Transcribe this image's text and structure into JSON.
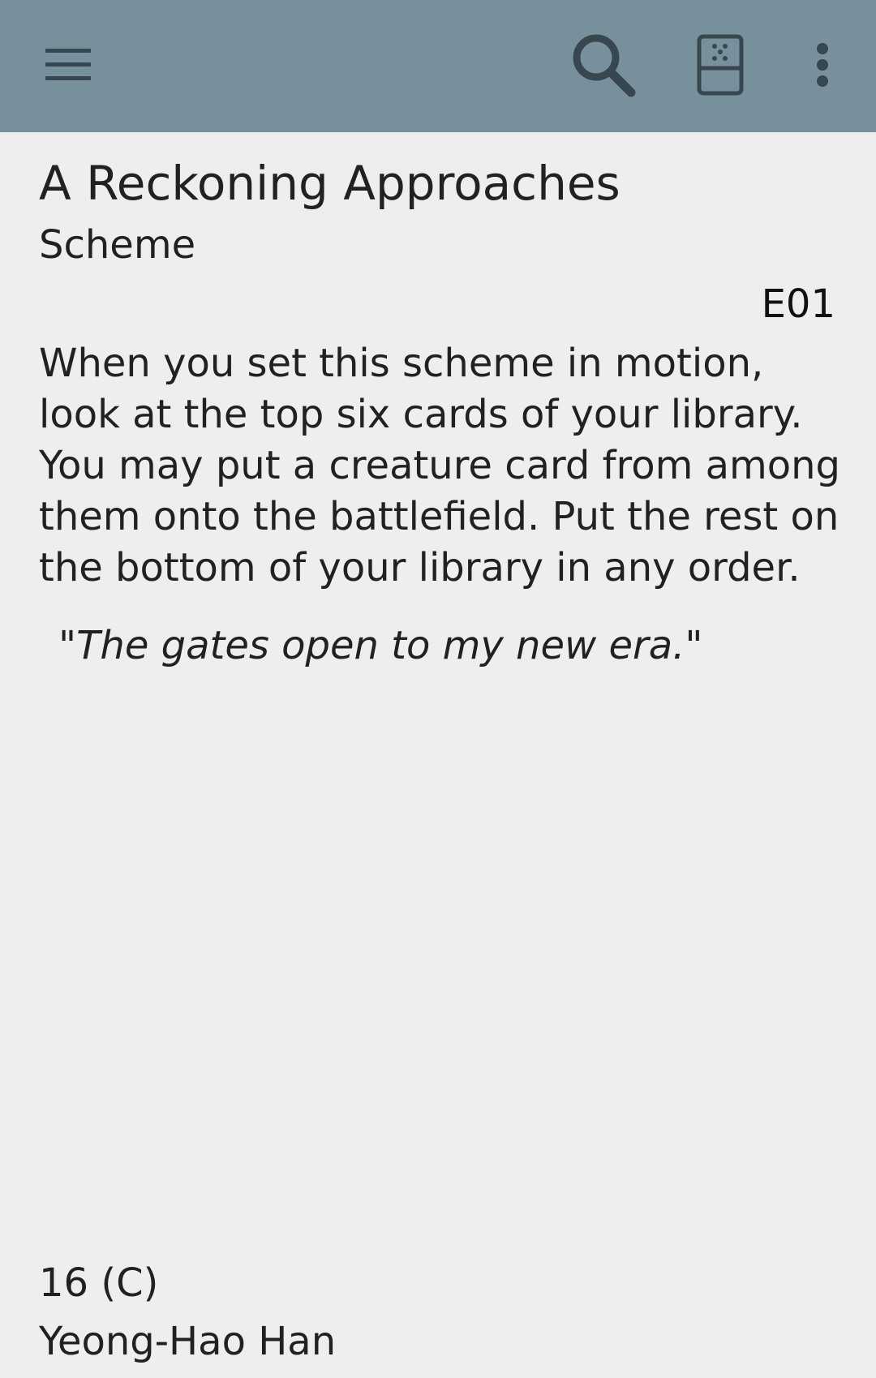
{
  "app_bar": {
    "background_color": "#78909c",
    "icon_color": "#37474f",
    "icons": [
      "menu-icon",
      "search-icon",
      "random-card-icon",
      "more-vert-icon"
    ]
  },
  "card": {
    "name": "A Reckoning Approaches",
    "type": "Scheme",
    "set_number": "E01",
    "rules_text": "When you set this scheme in motion, look at the top six cards of your library. You may put a creature card from among them onto the battlefield. Put the rest on the bottom of your library in any order.",
    "flavor_text": "\"The gates open to my new era.\"",
    "collector_number": "16 (C)",
    "artist": "Yeong-Hao Han"
  },
  "colors": {
    "page_background": "#eeeeee",
    "text": "#212121"
  }
}
